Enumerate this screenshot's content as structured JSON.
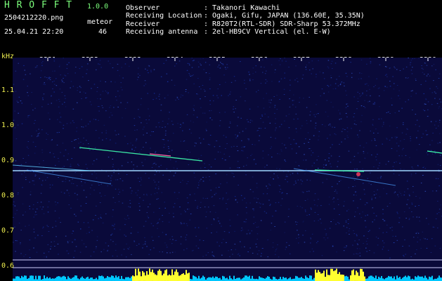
{
  "app": {
    "title": "H R O F F T",
    "version": "1.0.0",
    "filename": "2504212220.png",
    "timestamp": "25.04.21 22:20",
    "meteor_label": "meteor",
    "meteor_count": "46"
  },
  "station": {
    "observer_label": "Observer",
    "observer_value": ": Takanori Kawachi",
    "location_label": "Receiving Location",
    "location_value": ": Ogaki, Gifu, JAPAN (136.60E, 35.35N)",
    "receiver_label": "Receiver",
    "receiver_value": ": R820T2(RTL-SDR) SDR-Sharp 53.372MHz",
    "antenna_label": "Receiving antenna",
    "antenna_value": ": 2el-HB9CV Vertical (el. E-W)"
  },
  "axis": {
    "unit": "kHz",
    "time_ticks": [
      "2221",
      "2222",
      "2223",
      "2224",
      "2225",
      "2226",
      "2227",
      "2228",
      "2229",
      "2230"
    ],
    "freq_ticks": [
      "1.1",
      "1.0",
      "0.9",
      "0.8",
      "0.7",
      "0.6"
    ]
  },
  "colors": {
    "background": "#0a0a3a",
    "carrier": "#9fd8ff",
    "meteor": "#40ffb0",
    "level_bars": "#00c8ff",
    "level_peaks": "#ffff30"
  }
}
